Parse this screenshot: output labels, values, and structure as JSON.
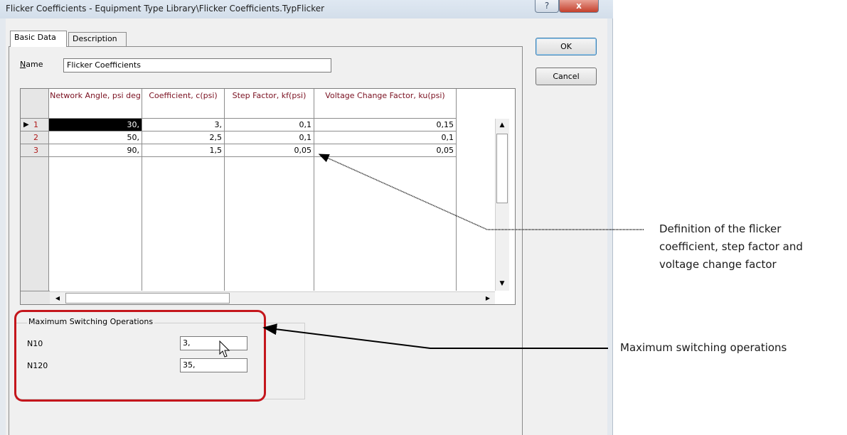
{
  "window": {
    "title": "Flicker Coefficients - Equipment Type Library\\Flicker Coefficients.TypFlicker",
    "help_label": "?",
    "close_label": "x"
  },
  "tabs": [
    {
      "label": "Basic Data",
      "active": true
    },
    {
      "label": "Description",
      "active": false
    }
  ],
  "form": {
    "name_label_first": "N",
    "name_label_rest": "ame",
    "name_value": "Flicker Coefficients"
  },
  "grid": {
    "columns": [
      "Network Angle, psi deg",
      "Coefficient, c(psi)",
      "Step Factor, kf(psi)",
      "Voltage Change Factor, ku(psi)"
    ],
    "rows": [
      {
        "index": "1",
        "cells": [
          "30,",
          "3,",
          "0,1",
          "0,15"
        ],
        "current": true
      },
      {
        "index": "2",
        "cells": [
          "50,",
          "2,5",
          "0,1",
          "0,1"
        ],
        "current": false
      },
      {
        "index": "3",
        "cells": [
          "90,",
          "1,5",
          "0,05",
          "0,05"
        ],
        "current": false
      }
    ],
    "current_row_marker": "▶"
  },
  "buttons": {
    "ok": "OK",
    "cancel": "Cancel"
  },
  "switching": {
    "group_title": "Maximum Switching Operations",
    "n10_label": "N10",
    "n10_value": "3,",
    "n120_label": "N120",
    "n120_value": "35,"
  },
  "annotations": {
    "grid_note": [
      "Definition of the flicker",
      "coefficient, step factor and",
      "voltage change factor"
    ],
    "switching_note": "Maximum switching operations"
  },
  "colors": {
    "header_text": "#7a1020",
    "row_index_text": "#b01a1a",
    "highlight_box": "#c4161c"
  },
  "icons": {
    "scroll_up": "▲",
    "scroll_down": "▼",
    "scroll_left": "◀",
    "scroll_right": "▶"
  }
}
